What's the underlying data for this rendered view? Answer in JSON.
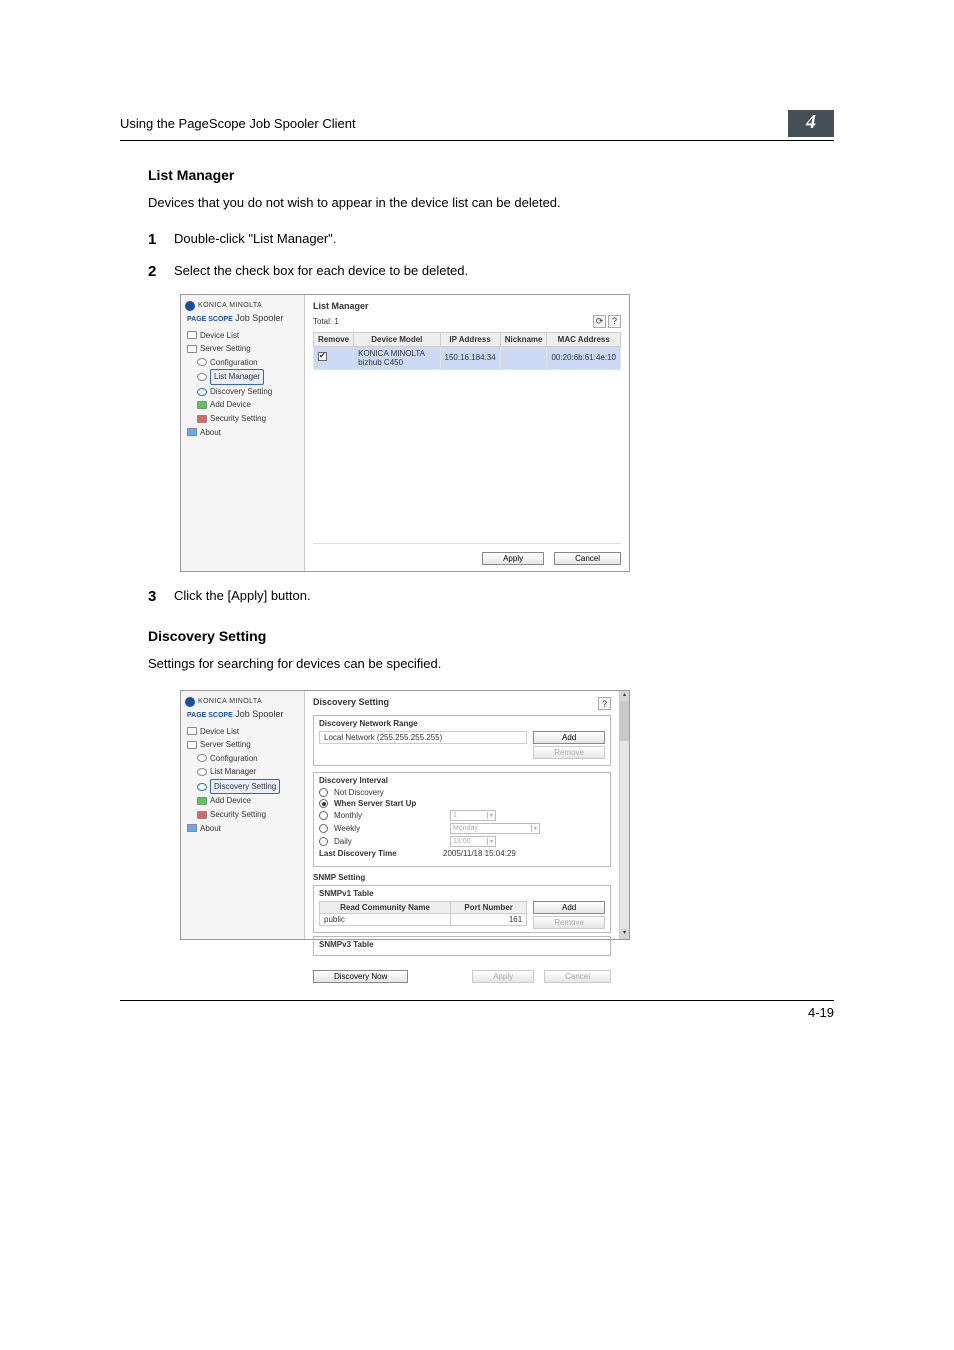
{
  "header": {
    "title": "Using the PageScope Job Spooler Client",
    "badge": "4"
  },
  "sec1": {
    "heading": "List Manager",
    "intro": "Devices that you do not wish to appear in the device list can be deleted.",
    "step1": "Double-click \"List Manager\".",
    "step2": "Select the check box for each device to be deleted.",
    "step3": "Click the [Apply] button."
  },
  "sec2": {
    "heading": "Discovery Setting",
    "intro": "Settings for searching for devices can be specified."
  },
  "brand": {
    "name": "KONICA MINOLTA",
    "prefix": "PAGE SCOPE",
    "product": "Job Spooler"
  },
  "nav": {
    "device_list": "Device List",
    "server_setting": "Server Setting",
    "configuration": "Configuration",
    "list_manager": "List Manager",
    "discovery_setting": "Discovery Setting",
    "add_device": "Add Device",
    "security_setting": "Security Setting",
    "about": "About"
  },
  "ss1": {
    "title": "List Manager",
    "total": "Total: 1",
    "cols": {
      "remove": "Remove",
      "model": "Device Model",
      "ip": "IP Address",
      "nick": "Nickname",
      "mac": "MAC Address"
    },
    "row": {
      "model": "KONICA MINOLTA bizhub C450",
      "ip": "150.16.184.34",
      "nick": "",
      "mac": "00:20:6b:61:4e:10"
    },
    "apply": "Apply",
    "cancel": "Cancel",
    "refresh_glyph": "⟳",
    "help_glyph": "?"
  },
  "ss2": {
    "title": "Discovery Setting",
    "net_range": "Discovery Network Range",
    "local_net": "Local Network (255.255.255.255)",
    "add": "Add",
    "remove": "Remove",
    "interval": "Discovery Interval",
    "not_discovery": "Not Discovery",
    "when_start": "When Server Start Up",
    "monthly": "Monthly",
    "weekly": "Weekly",
    "daily": "Daily",
    "monthly_val": "1",
    "weekly_val": "Monday",
    "daily_val": "13:00",
    "last_discovery_label": "Last Discovery Time",
    "last_discovery_val": "2005/11/18 15:04:29",
    "snmp_setting": "SNMP Setting",
    "snmpv1": "SNMPv1 Table",
    "col_read": "Read Community Name",
    "col_port": "Port Number",
    "row_read": "public",
    "row_port": "161",
    "snmpv3": "SNMPv3 Table",
    "discover_now": "Discovery Now",
    "apply": "Apply",
    "cancel": "Cancel",
    "help_glyph": "?"
  },
  "footer": {
    "pagenum": "4-19"
  }
}
